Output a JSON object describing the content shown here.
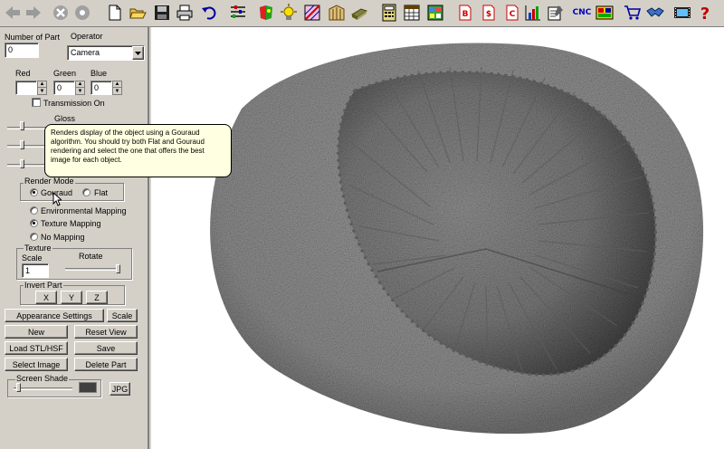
{
  "toolbar": {
    "icons": [
      "back-arrow-icon",
      "forward-arrow-icon",
      "stop-icon",
      "home-icon",
      "new-file-icon",
      "open-folder-icon",
      "save-disk-icon",
      "print-icon",
      "undo-icon",
      "properties-icon",
      "color-palette-icon",
      "light-icon",
      "texture-icon",
      "wireframe-icon",
      "surface-icon",
      "calculator-icon",
      "calendar-icon",
      "grid-icon",
      "report-b-icon",
      "report-dollar-icon",
      "report-c-icon",
      "chart-icon",
      "note-icon",
      "gauge-icon",
      "display-icon",
      "cart-icon",
      "handshake-icon",
      "film-icon",
      "help-icon"
    ],
    "cnc_label": "CNC"
  },
  "panel": {
    "number_of_part_label": "Number of Part",
    "number_of_part_value": "0",
    "operator_label": "Operator",
    "operator_value": "Camera",
    "red_label": "Red",
    "green_label": "Green",
    "blue_label": "Blue",
    "red_value": "",
    "green_value": "0",
    "blue_value": "0",
    "transmission_label": "Transmission On",
    "gloss_label": "Gloss",
    "render_mode_label": "Render Mode",
    "gouraud_label": "Gouraud",
    "flat_label": "Flat",
    "env_mapping_label": "Environmental Mapping",
    "texture_mapping_label": "Texture Mapping",
    "no_mapping_label": "No Mapping",
    "texture_label": "Texture",
    "scale_label": "Scale",
    "scale_value": "1",
    "rotate_label": "Rotate",
    "invert_part_label": "Invert Part",
    "x_label": "X",
    "y_label": "Y",
    "z_label": "Z",
    "appearance_settings_label": "Appearance Settings",
    "scale_button_label": "Scale",
    "new_label": "New",
    "reset_view_label": "Reset View",
    "load_label": "Load STL/HSF",
    "save_label": "Save",
    "select_image_label": "Select Image",
    "delete_part_label": "Delete Part",
    "screen_shade_label": "Screen Shade",
    "jpg_label": "JPG"
  },
  "tooltip": {
    "text": "Renders display of the object using a Gouraud algorithm. You should try both Flat and Gouraud rendering and select the one that offers the best image for each object."
  },
  "colors": {
    "background": "#d4d0c8",
    "tooltip_background": "#ffffe1",
    "model_gray": "#8a8a8a"
  }
}
